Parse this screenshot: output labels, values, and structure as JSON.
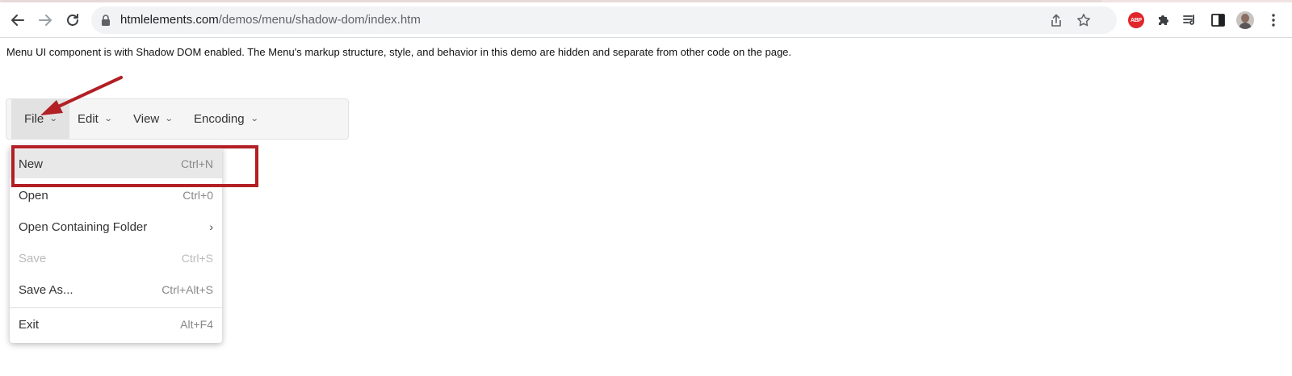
{
  "browser": {
    "url_domain": "htmlelements.com",
    "url_path": "/demos/menu/shadow-dom/index.htm",
    "abp_label": "ABP"
  },
  "page": {
    "description": "Menu UI component is with Shadow DOM enabled. The Menu's markup structure, style, and behavior in this demo are hidden and separate from other code on the page."
  },
  "menubar": {
    "items": [
      {
        "label": "File",
        "chevron": "⌄"
      },
      {
        "label": "Edit",
        "chevron": "⌄"
      },
      {
        "label": "View",
        "chevron": "⌄"
      },
      {
        "label": "Encoding",
        "chevron": "⌄"
      }
    ]
  },
  "dropdown": {
    "items": [
      {
        "label": "New",
        "shortcut": "Ctrl+N"
      },
      {
        "label": "Open",
        "shortcut": "Ctrl+0"
      },
      {
        "label": "Open Containing Folder",
        "shortcut": "›"
      },
      {
        "label": "Save",
        "shortcut": "Ctrl+S"
      },
      {
        "label": "Save As...",
        "shortcut": "Ctrl+Alt+S"
      },
      {
        "label": "Exit",
        "shortcut": "Alt+F4"
      }
    ]
  },
  "colors": {
    "annotation_red": "#b21f24",
    "menubar_bg": "#f5f5f5",
    "highlight_bg": "#e8e8e8"
  }
}
